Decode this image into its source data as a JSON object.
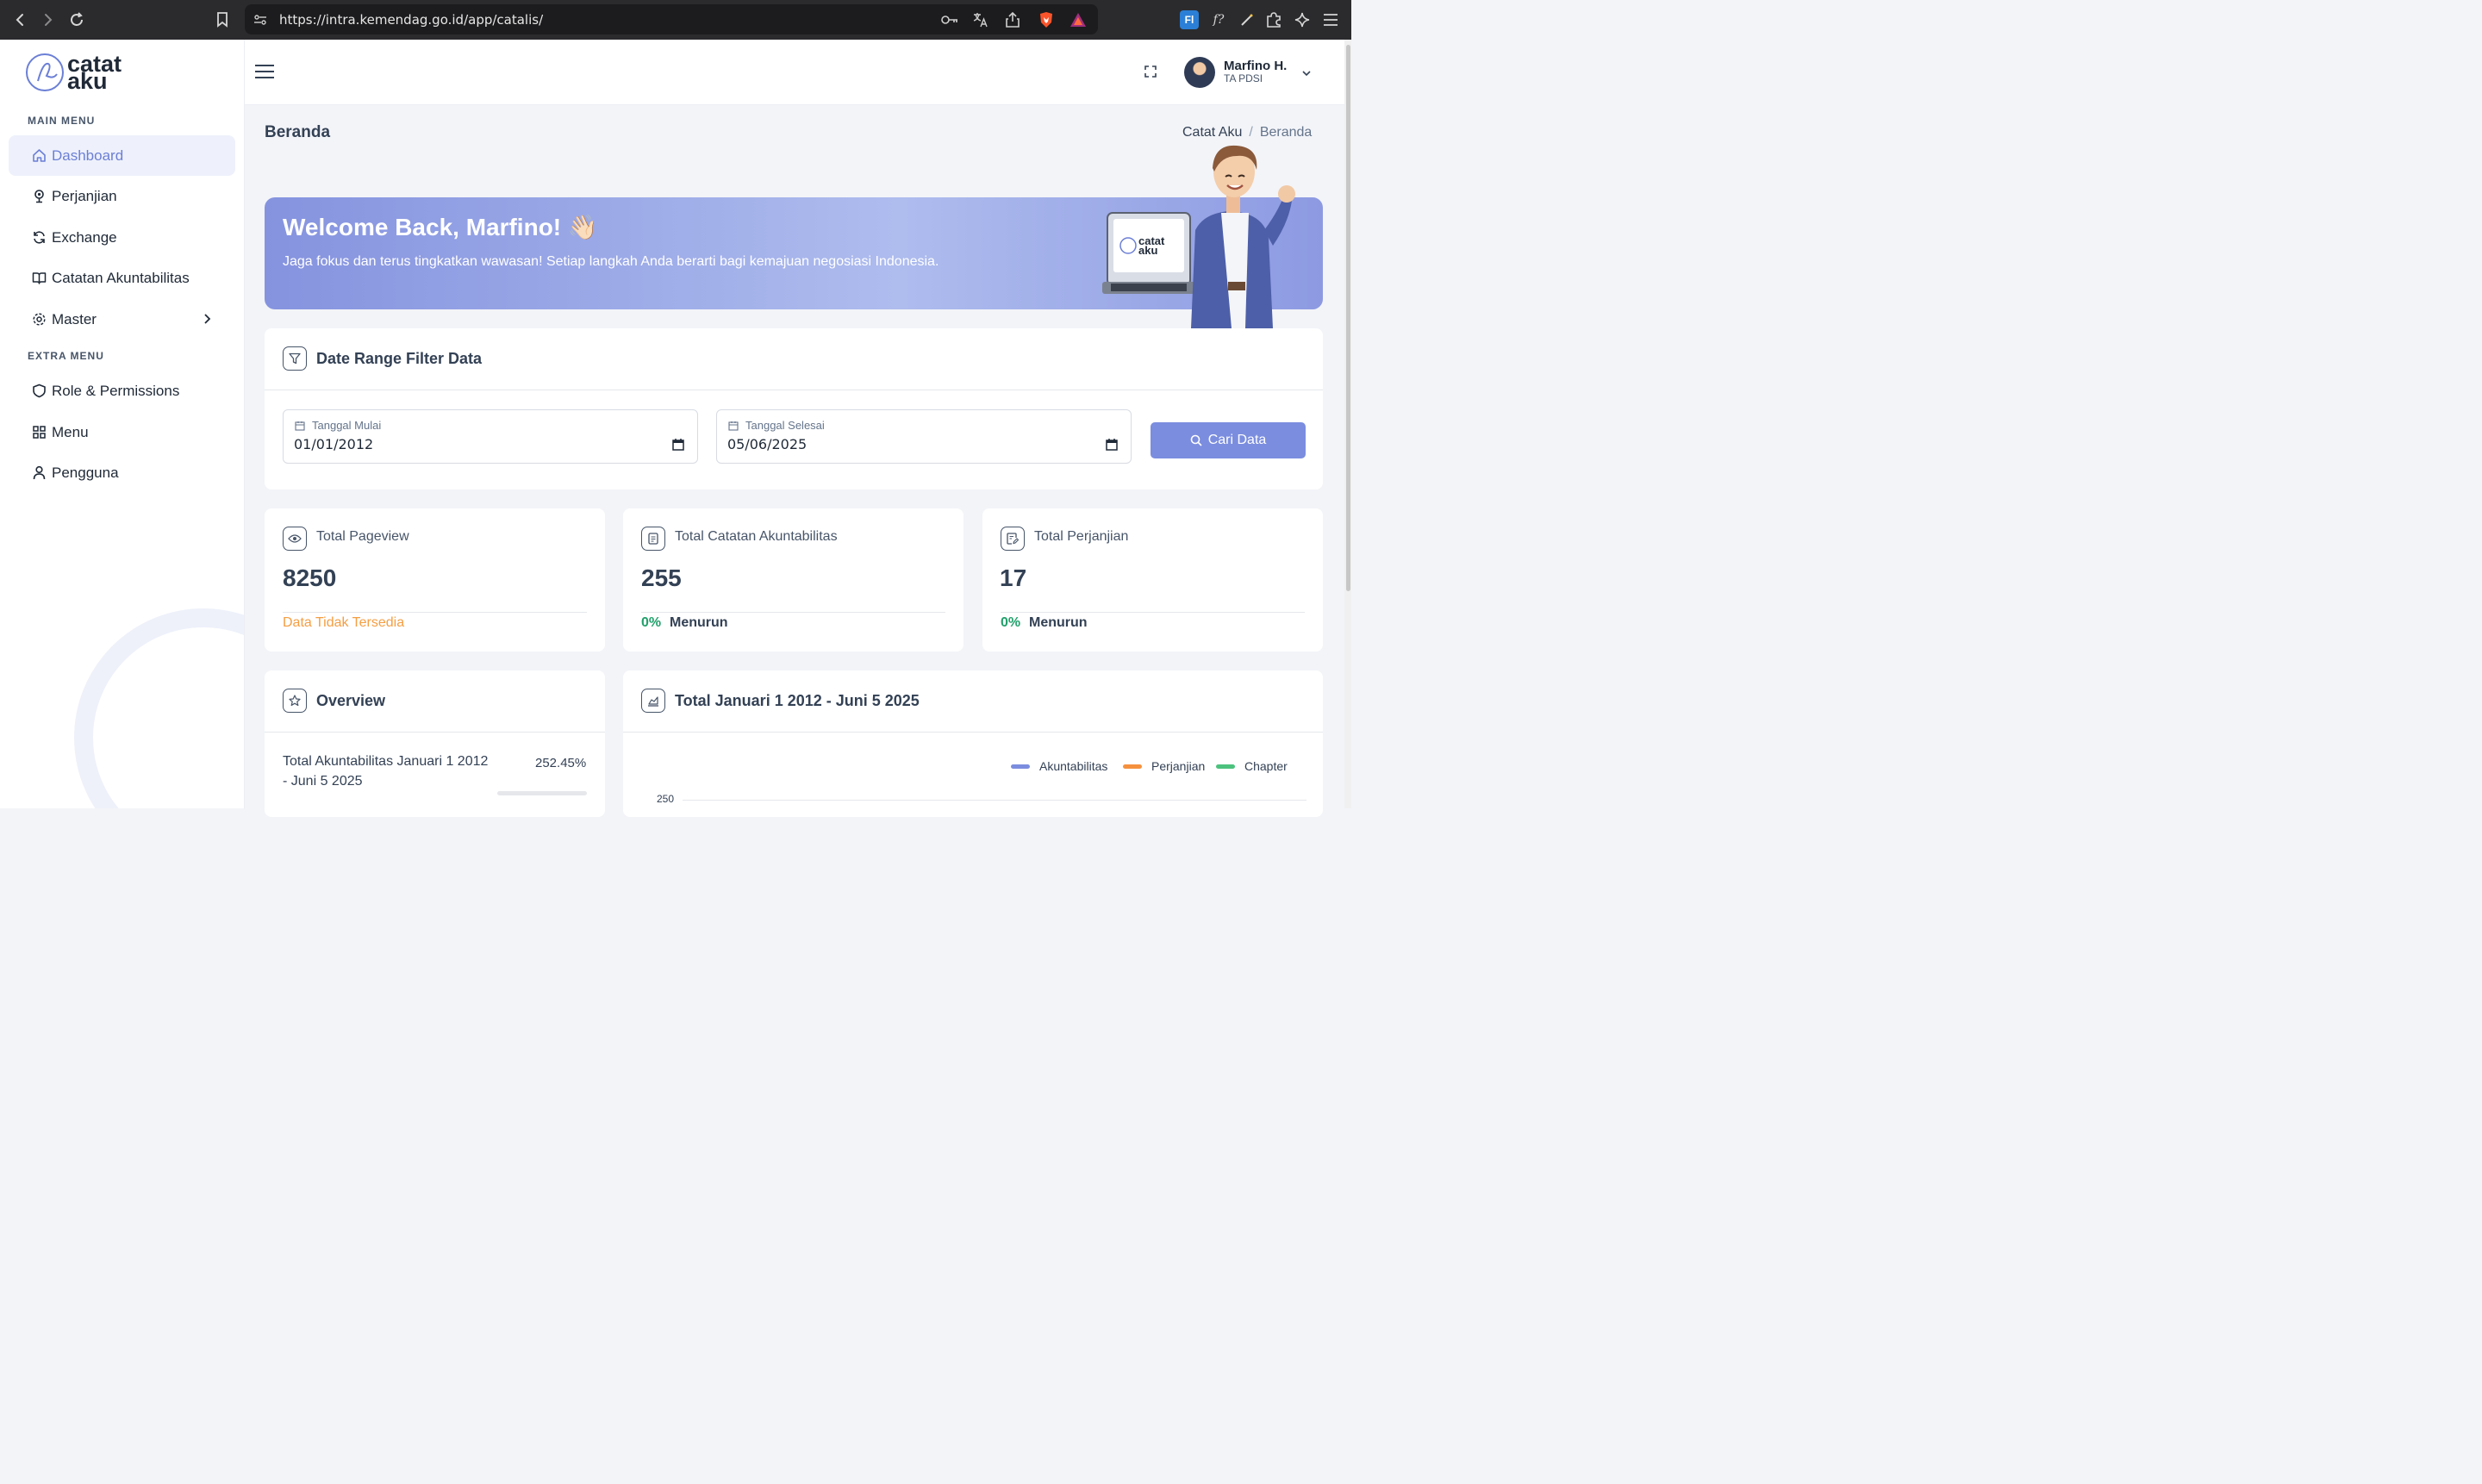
{
  "browser": {
    "url": "https://intra.kemendag.go.id/app/catalis/"
  },
  "sidebar": {
    "logo_line1": "catat",
    "logo_line2": "aku",
    "main_menu_label": "MAIN MENU",
    "main_items": [
      {
        "label": "Dashboard",
        "icon": "home-icon",
        "active": true
      },
      {
        "label": "Perjanjian",
        "icon": "pin-icon"
      },
      {
        "label": "Exchange",
        "icon": "refresh-icon"
      },
      {
        "label": "Catatan Akuntabilitas",
        "icon": "book-icon"
      },
      {
        "label": "Master",
        "icon": "gear-icon",
        "has_submenu": true
      }
    ],
    "extra_menu_label": "EXTRA MENU",
    "extra_items": [
      {
        "label": "Role & Permissions",
        "icon": "shield-icon"
      },
      {
        "label": "Menu",
        "icon": "grid-icon"
      },
      {
        "label": "Pengguna",
        "icon": "user-icon"
      }
    ]
  },
  "header": {
    "user_name": "Marfino H.",
    "user_role": "TA PDSI"
  },
  "page": {
    "title": "Beranda",
    "breadcrumb": [
      "Catat Aku",
      "Beranda"
    ]
  },
  "welcome": {
    "title": "Welcome Back, Marfino! 👋🏻",
    "message": "Jaga fokus dan terus tingkatkan wawasan! Setiap langkah Anda berarti bagi kemajuan negosiasi Indonesia.",
    "laptop_logo_line1": "catat",
    "laptop_logo_line2": "aku"
  },
  "filter": {
    "title": "Date Range Filter Data",
    "start_label": "Tanggal Mulai",
    "start_value": "01/01/2012",
    "end_label": "Tanggal Selesai",
    "end_value": "05/06/2025",
    "button_label": "Cari Data"
  },
  "stats": [
    {
      "label": "Total Pageview",
      "value": "8250",
      "note": "Data Tidak Tersedia",
      "icon": "eye-icon"
    },
    {
      "label": "Total Catatan Akuntabilitas",
      "value": "255",
      "pct": "0%",
      "trend": "Menurun",
      "icon": "document-icon"
    },
    {
      "label": "Total Perjanjian",
      "value": "17",
      "pct": "0%",
      "trend": "Menurun",
      "icon": "edit-document-icon"
    }
  ],
  "overview": {
    "title": "Overview",
    "item_label": "Total Akuntabilitas Januari 1 2012 - Juni 5 2025",
    "item_pct": "252.45%"
  },
  "chart_card": {
    "title": "Total Januari 1 2012 - Juni 5 2025"
  },
  "chart_data": {
    "type": "line",
    "series": [
      {
        "name": "Akuntabilitas",
        "color": "#7b8ddf",
        "values": []
      },
      {
        "name": "Perjanjian",
        "color": "#f5913e",
        "values": []
      },
      {
        "name": "Chapter",
        "color": "#4cc27e",
        "values": []
      }
    ],
    "yticks_visible": [
      "250"
    ],
    "legend": "top-right"
  }
}
